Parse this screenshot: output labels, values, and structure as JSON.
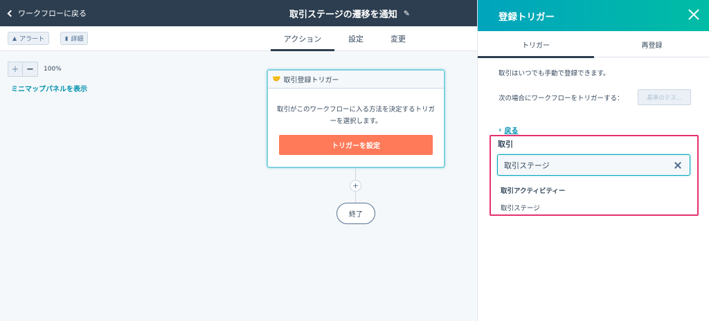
{
  "header": {
    "back_label": "ワークフローに戻る",
    "workflow_title": "取引ステージの遷移を通知"
  },
  "toolbar": {
    "alert_label": "アラート",
    "details_label": "詳細",
    "tabs": [
      {
        "label": "アクション",
        "active": true
      },
      {
        "label": "設定",
        "active": false
      },
      {
        "label": "変更",
        "active": false
      }
    ]
  },
  "canvas": {
    "zoom_level": "100%",
    "minimap_link": "ミニマップパネルを表示",
    "trigger_card": {
      "title": "取引登録トリガー",
      "description": "取引がこのワークフローに入る方法を決定するトリガーを選択します。",
      "button_label": "トリガーを設定"
    },
    "add_action": "+",
    "end_label": "終了"
  },
  "panel": {
    "title": "登録トリガー",
    "tabs": [
      {
        "label": "トリガー",
        "active": true
      },
      {
        "label": "再登録",
        "active": false
      }
    ],
    "manual_text": "取引はいつでも手動で登録できます。",
    "trigger_when_text": "次の場合にワークフローをトリガーする：",
    "criteria_button": "基準のテス...",
    "back_label": "戻る",
    "group_label": "取引",
    "search_value": "取引ステージ",
    "results": {
      "group": "取引アクティビティー",
      "item": "取引ステージ"
    }
  },
  "colors": {
    "header_bg": "#2d3e50",
    "panel_gradient_start": "#00a4bd",
    "panel_gradient_end": "#00bda5",
    "primary_button": "#ff7a59",
    "link": "#0091ae",
    "highlight_border": "#e5306e"
  },
  "icons": {
    "back": "chevron-left-icon",
    "edit": "pencil-icon",
    "alert": "warning-icon",
    "details": "bar-chart-icon",
    "trigger": "handshake-icon",
    "close": "close-icon",
    "clear": "clear-icon"
  }
}
